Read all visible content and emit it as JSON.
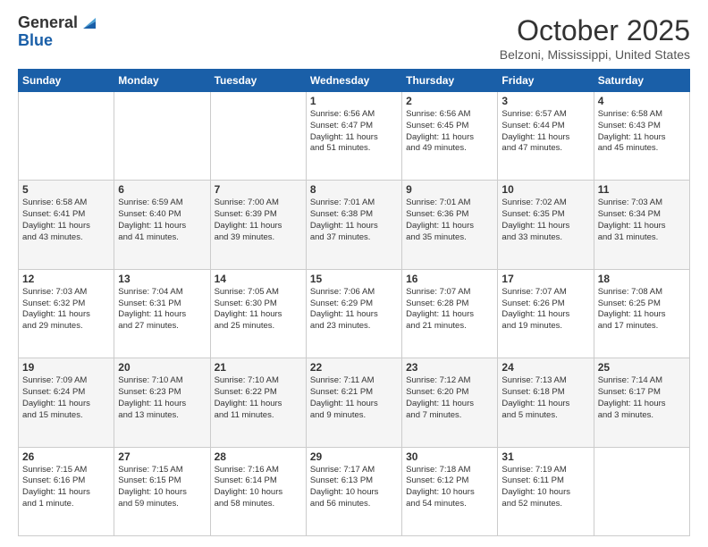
{
  "logo": {
    "general": "General",
    "blue": "Blue"
  },
  "header": {
    "month": "October 2025",
    "location": "Belzoni, Mississippi, United States"
  },
  "weekdays": [
    "Sunday",
    "Monday",
    "Tuesday",
    "Wednesday",
    "Thursday",
    "Friday",
    "Saturday"
  ],
  "weeks": [
    [
      {
        "day": "",
        "content": ""
      },
      {
        "day": "",
        "content": ""
      },
      {
        "day": "",
        "content": ""
      },
      {
        "day": "1",
        "content": "Sunrise: 6:56 AM\nSunset: 6:47 PM\nDaylight: 11 hours\nand 51 minutes."
      },
      {
        "day": "2",
        "content": "Sunrise: 6:56 AM\nSunset: 6:45 PM\nDaylight: 11 hours\nand 49 minutes."
      },
      {
        "day": "3",
        "content": "Sunrise: 6:57 AM\nSunset: 6:44 PM\nDaylight: 11 hours\nand 47 minutes."
      },
      {
        "day": "4",
        "content": "Sunrise: 6:58 AM\nSunset: 6:43 PM\nDaylight: 11 hours\nand 45 minutes."
      }
    ],
    [
      {
        "day": "5",
        "content": "Sunrise: 6:58 AM\nSunset: 6:41 PM\nDaylight: 11 hours\nand 43 minutes."
      },
      {
        "day": "6",
        "content": "Sunrise: 6:59 AM\nSunset: 6:40 PM\nDaylight: 11 hours\nand 41 minutes."
      },
      {
        "day": "7",
        "content": "Sunrise: 7:00 AM\nSunset: 6:39 PM\nDaylight: 11 hours\nand 39 minutes."
      },
      {
        "day": "8",
        "content": "Sunrise: 7:01 AM\nSunset: 6:38 PM\nDaylight: 11 hours\nand 37 minutes."
      },
      {
        "day": "9",
        "content": "Sunrise: 7:01 AM\nSunset: 6:36 PM\nDaylight: 11 hours\nand 35 minutes."
      },
      {
        "day": "10",
        "content": "Sunrise: 7:02 AM\nSunset: 6:35 PM\nDaylight: 11 hours\nand 33 minutes."
      },
      {
        "day": "11",
        "content": "Sunrise: 7:03 AM\nSunset: 6:34 PM\nDaylight: 11 hours\nand 31 minutes."
      }
    ],
    [
      {
        "day": "12",
        "content": "Sunrise: 7:03 AM\nSunset: 6:32 PM\nDaylight: 11 hours\nand 29 minutes."
      },
      {
        "day": "13",
        "content": "Sunrise: 7:04 AM\nSunset: 6:31 PM\nDaylight: 11 hours\nand 27 minutes."
      },
      {
        "day": "14",
        "content": "Sunrise: 7:05 AM\nSunset: 6:30 PM\nDaylight: 11 hours\nand 25 minutes."
      },
      {
        "day": "15",
        "content": "Sunrise: 7:06 AM\nSunset: 6:29 PM\nDaylight: 11 hours\nand 23 minutes."
      },
      {
        "day": "16",
        "content": "Sunrise: 7:07 AM\nSunset: 6:28 PM\nDaylight: 11 hours\nand 21 minutes."
      },
      {
        "day": "17",
        "content": "Sunrise: 7:07 AM\nSunset: 6:26 PM\nDaylight: 11 hours\nand 19 minutes."
      },
      {
        "day": "18",
        "content": "Sunrise: 7:08 AM\nSunset: 6:25 PM\nDaylight: 11 hours\nand 17 minutes."
      }
    ],
    [
      {
        "day": "19",
        "content": "Sunrise: 7:09 AM\nSunset: 6:24 PM\nDaylight: 11 hours\nand 15 minutes."
      },
      {
        "day": "20",
        "content": "Sunrise: 7:10 AM\nSunset: 6:23 PM\nDaylight: 11 hours\nand 13 minutes."
      },
      {
        "day": "21",
        "content": "Sunrise: 7:10 AM\nSunset: 6:22 PM\nDaylight: 11 hours\nand 11 minutes."
      },
      {
        "day": "22",
        "content": "Sunrise: 7:11 AM\nSunset: 6:21 PM\nDaylight: 11 hours\nand 9 minutes."
      },
      {
        "day": "23",
        "content": "Sunrise: 7:12 AM\nSunset: 6:20 PM\nDaylight: 11 hours\nand 7 minutes."
      },
      {
        "day": "24",
        "content": "Sunrise: 7:13 AM\nSunset: 6:18 PM\nDaylight: 11 hours\nand 5 minutes."
      },
      {
        "day": "25",
        "content": "Sunrise: 7:14 AM\nSunset: 6:17 PM\nDaylight: 11 hours\nand 3 minutes."
      }
    ],
    [
      {
        "day": "26",
        "content": "Sunrise: 7:15 AM\nSunset: 6:16 PM\nDaylight: 11 hours\nand 1 minute."
      },
      {
        "day": "27",
        "content": "Sunrise: 7:15 AM\nSunset: 6:15 PM\nDaylight: 10 hours\nand 59 minutes."
      },
      {
        "day": "28",
        "content": "Sunrise: 7:16 AM\nSunset: 6:14 PM\nDaylight: 10 hours\nand 58 minutes."
      },
      {
        "day": "29",
        "content": "Sunrise: 7:17 AM\nSunset: 6:13 PM\nDaylight: 10 hours\nand 56 minutes."
      },
      {
        "day": "30",
        "content": "Sunrise: 7:18 AM\nSunset: 6:12 PM\nDaylight: 10 hours\nand 54 minutes."
      },
      {
        "day": "31",
        "content": "Sunrise: 7:19 AM\nSunset: 6:11 PM\nDaylight: 10 hours\nand 52 minutes."
      },
      {
        "day": "",
        "content": ""
      }
    ]
  ]
}
